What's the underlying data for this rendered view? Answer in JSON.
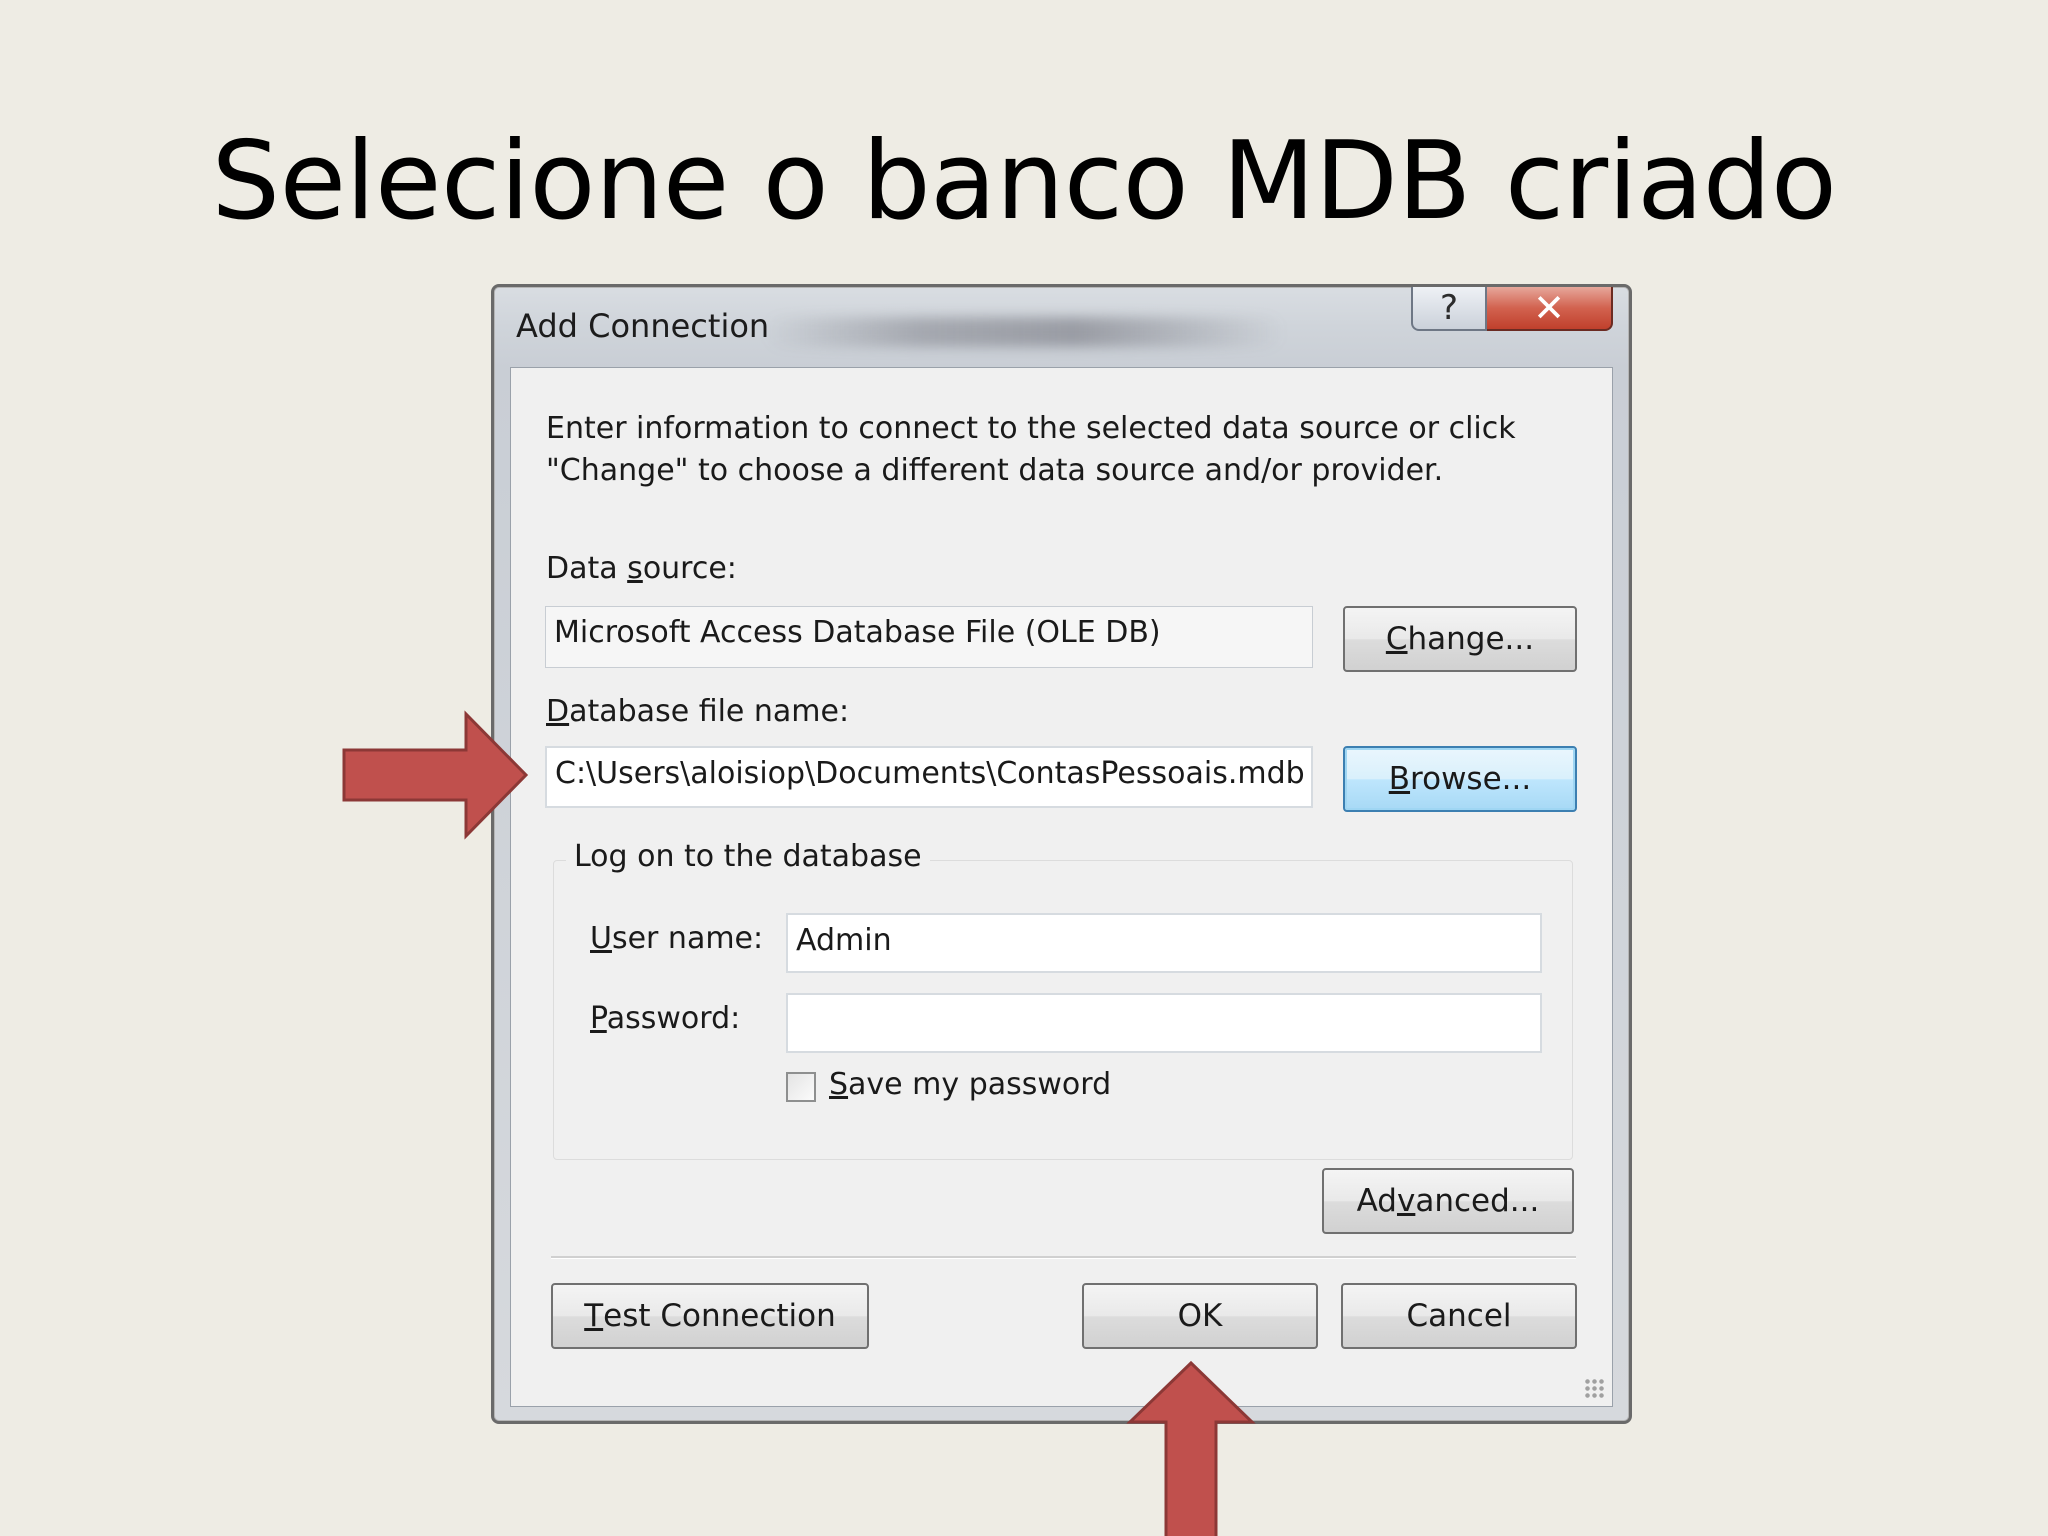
{
  "slide": {
    "title": "Selecione o banco MDB criado"
  },
  "dialog": {
    "title": "Add Connection",
    "help_glyph": "?",
    "close_glyph": "✕",
    "intro_line1": "Enter information to connect to the selected data source or click",
    "intro_line2": "\"Change\" to choose a different data source and/or provider.",
    "data_source": {
      "label_pre": "Data ",
      "label_accel": "s",
      "label_post": "ource:",
      "value": "Microsoft Access Database File (OLE DB)",
      "change_pre": "",
      "change_accel": "C",
      "change_post": "hange..."
    },
    "database_file": {
      "label_pre": "",
      "label_accel": "D",
      "label_post": "atabase file name:",
      "value": "C:\\Users\\aloisiop\\Documents\\ContasPessoais.mdb",
      "browse_pre": "",
      "browse_accel": "B",
      "browse_post": "rowse..."
    },
    "logon": {
      "group_title": "Log on to the database",
      "user_label_pre": "",
      "user_label_accel": "U",
      "user_label_post": "ser name:",
      "user_value": "Admin",
      "password_label_pre": "",
      "password_label_accel": "P",
      "password_label_post": "assword:",
      "password_value": "",
      "save_pre": "",
      "save_accel": "S",
      "save_post": "ave my password",
      "save_checked": false
    },
    "buttons": {
      "advanced_pre": "Ad",
      "advanced_accel": "v",
      "advanced_post": "anced...",
      "test_pre": "",
      "test_accel": "T",
      "test_post": "est Connection",
      "ok": "OK",
      "cancel": "Cancel"
    }
  },
  "colors": {
    "arrow_fill": "#c0504d",
    "arrow_stroke": "#8c3836",
    "slide_background": "#eeece4"
  }
}
